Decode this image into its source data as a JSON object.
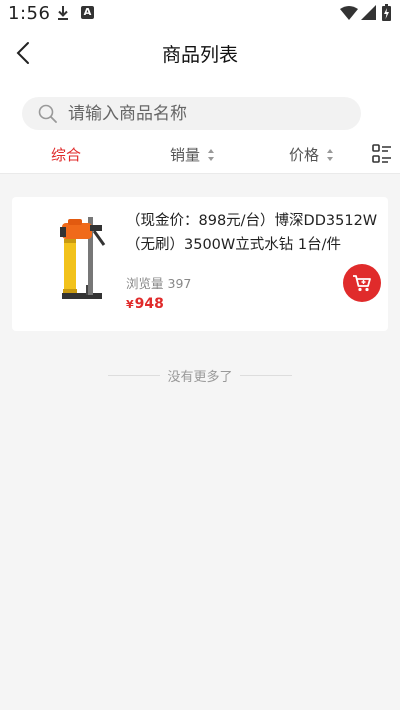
{
  "status_bar": {
    "time": "1:56",
    "notification_letter": "A"
  },
  "header": {
    "title": "商品列表"
  },
  "search": {
    "placeholder": "请输入商品名称",
    "value": ""
  },
  "sort_bar": {
    "items": [
      {
        "label": "综合",
        "active": true
      },
      {
        "label": "销量",
        "active": false
      },
      {
        "label": "价格",
        "active": false
      }
    ]
  },
  "products": [
    {
      "name": "（现金价：898元/台）博深DD3512W（无刷）3500W立式水钻 1台/件",
      "views_label": "浏览量",
      "views": "397",
      "currency": "¥",
      "price": "948"
    }
  ],
  "list_end_text": "没有更多了",
  "colors": {
    "accent": "#e02b2b",
    "background": "#f5f5f5"
  }
}
